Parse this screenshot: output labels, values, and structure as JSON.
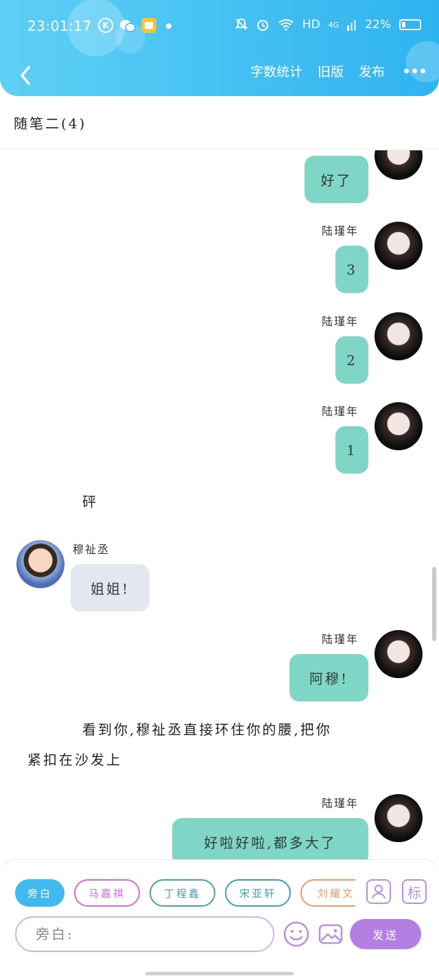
{
  "status_bar": {
    "time": "23:01:17",
    "k_badge": "K",
    "network": "HD",
    "signal": "4G",
    "battery": "22%"
  },
  "nav": {
    "actions": [
      "字数统计",
      "旧版",
      "发布"
    ]
  },
  "title": "随笔二(4)",
  "messages": [
    {
      "text": "好了"
    },
    {
      "speaker": "陆瑾年",
      "text": "3"
    },
    {
      "speaker": "陆瑾年",
      "text": "2"
    },
    {
      "speaker": "陆瑾年",
      "text": "1"
    },
    {
      "narration": "砰"
    },
    {
      "speaker": "穆祉丞",
      "text": "姐姐!"
    },
    {
      "speaker": "陆瑾年",
      "text": "阿穆!"
    },
    {
      "narration_line1": "看到你,穆祉丞直接环住你的腰,把你",
      "narration_line2": "紧扣在沙发上"
    },
    {
      "speaker": "陆瑾年",
      "text": "好啦好啦,都多大了"
    }
  ],
  "characters": [
    "旁白",
    "马嘉祺",
    "丁程鑫",
    "宋亚轩",
    "刘耀文"
  ],
  "colors": {
    "header": "#2fb3ef",
    "bubble_right": "#7fd6c7",
    "bubble_left": "#e3e8f0",
    "send": "#b47fe2",
    "chip_active": "#3fb9ee",
    "chip_ma": "#d86ad9",
    "chip_ding": "#49a0a5",
    "chip_song": "#3d9fb1",
    "chip_liu": "#ef9a6a"
  },
  "input": {
    "placeholder": "旁白:"
  },
  "tools": {
    "tag_label": "标"
  },
  "send_label": "发送"
}
